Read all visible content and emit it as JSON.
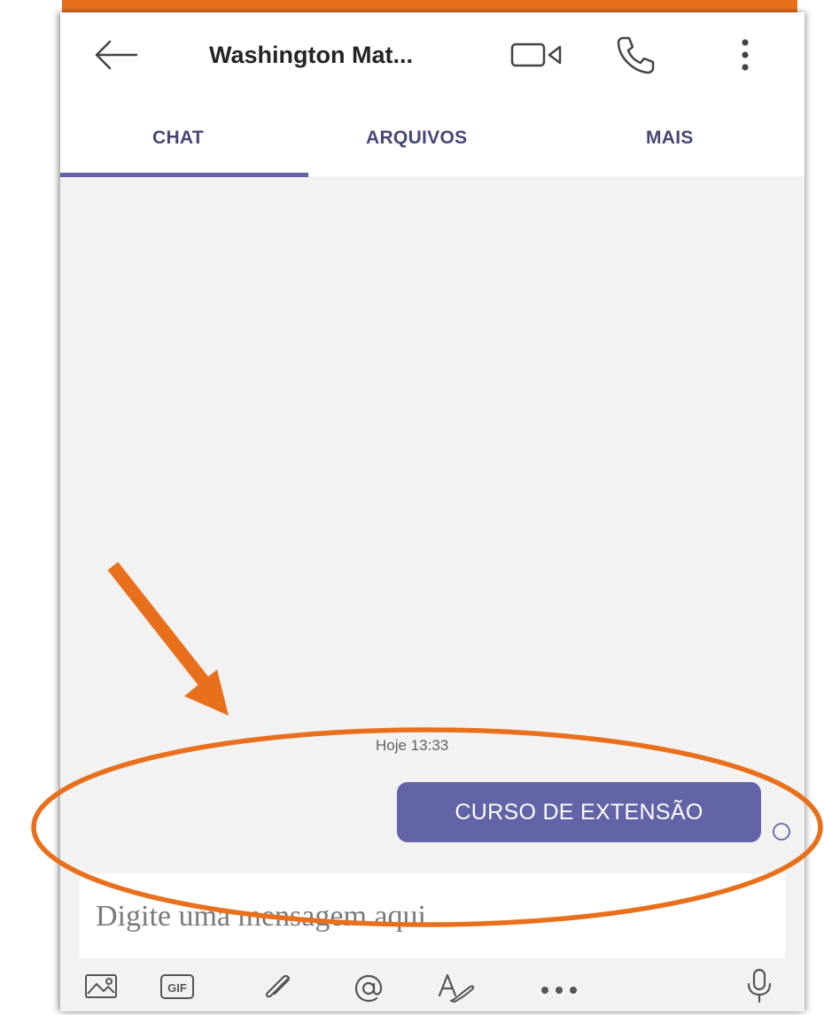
{
  "header": {
    "title": "Washington Mat...",
    "back_icon": "arrow-left-icon",
    "actions": [
      "video-camera-icon",
      "phone-icon",
      "more-vertical-icon"
    ]
  },
  "tabs": [
    {
      "label": "CHAT",
      "active": true
    },
    {
      "label": "ARQUIVOS",
      "active": false
    },
    {
      "label": "MAIS",
      "active": false
    }
  ],
  "chat": {
    "timestamp": "Hoje 13:33",
    "messages": [
      {
        "text": "CURSO DE EXTENSÃO",
        "sent": true
      }
    ]
  },
  "composer": {
    "placeholder": "Digite uma mensagem aqui",
    "gif_label": "GIF",
    "tools": [
      "image-icon",
      "gif-icon",
      "attach-icon",
      "mention-icon",
      "format-icon",
      "more-horizontal-icon",
      "microphone-icon"
    ]
  },
  "colors": {
    "accent": "#6264a7",
    "annotation": "#e8701c",
    "background": "#f2f2f2"
  }
}
